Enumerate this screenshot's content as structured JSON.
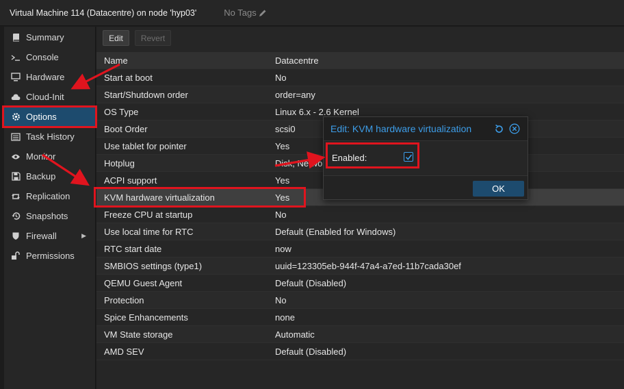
{
  "header": {
    "title": "Virtual Machine 114 (Datacentre) on node 'hyp03'",
    "tags_label": "No Tags",
    "tags_icon": "pencil-icon"
  },
  "sidebar": {
    "items": [
      {
        "label": "Summary",
        "icon": "book-icon"
      },
      {
        "label": "Console",
        "icon": "terminal-icon"
      },
      {
        "label": "Hardware",
        "icon": "desktop-icon"
      },
      {
        "label": "Cloud-Init",
        "icon": "cloud-icon"
      },
      {
        "label": "Options",
        "icon": "gear-icon",
        "active": true
      },
      {
        "label": "Task History",
        "icon": "list-icon"
      },
      {
        "label": "Monitor",
        "icon": "eye-icon"
      },
      {
        "label": "Backup",
        "icon": "floppy-icon"
      },
      {
        "label": "Replication",
        "icon": "retweet-icon"
      },
      {
        "label": "Snapshots",
        "icon": "history-icon"
      },
      {
        "label": "Firewall",
        "icon": "shield-icon",
        "has_submenu": true
      },
      {
        "label": "Permissions",
        "icon": "unlock-icon"
      }
    ]
  },
  "toolbar": {
    "edit_label": "Edit",
    "revert_label": "Revert"
  },
  "options": {
    "rows": [
      {
        "key": "Name",
        "value": "Datacentre"
      },
      {
        "key": "Start at boot",
        "value": "No"
      },
      {
        "key": "Start/Shutdown order",
        "value": "order=any"
      },
      {
        "key": "OS Type",
        "value": "Linux 6.x - 2.6 Kernel"
      },
      {
        "key": "Boot Order",
        "value": "scsi0"
      },
      {
        "key": "Use tablet for pointer",
        "value": "Yes"
      },
      {
        "key": "Hotplug",
        "value": "Disk, Network, USB"
      },
      {
        "key": "ACPI support",
        "value": "Yes"
      },
      {
        "key": "KVM hardware virtualization",
        "value": "Yes"
      },
      {
        "key": "Freeze CPU at startup",
        "value": "No"
      },
      {
        "key": "Use local time for RTC",
        "value": "Default (Enabled for Windows)"
      },
      {
        "key": "RTC start date",
        "value": "now"
      },
      {
        "key": "SMBIOS settings (type1)",
        "value": "uuid=123305eb-944f-47a4-a7ed-11b7cada30ef"
      },
      {
        "key": "QEMU Guest Agent",
        "value": "Default (Disabled)"
      },
      {
        "key": "Protection",
        "value": "No"
      },
      {
        "key": "Spice Enhancements",
        "value": "none"
      },
      {
        "key": "VM State storage",
        "value": "Automatic"
      },
      {
        "key": "AMD SEV",
        "value": "Default (Disabled)"
      }
    ]
  },
  "dialog": {
    "title": "Edit: KVM hardware virtualization",
    "field_label": "Enabled:",
    "checked": true,
    "ok_label": "OK"
  },
  "colors": {
    "accent": "#3d9de8",
    "active_nav": "#1d4b6e",
    "annotation": "#e0141e"
  }
}
